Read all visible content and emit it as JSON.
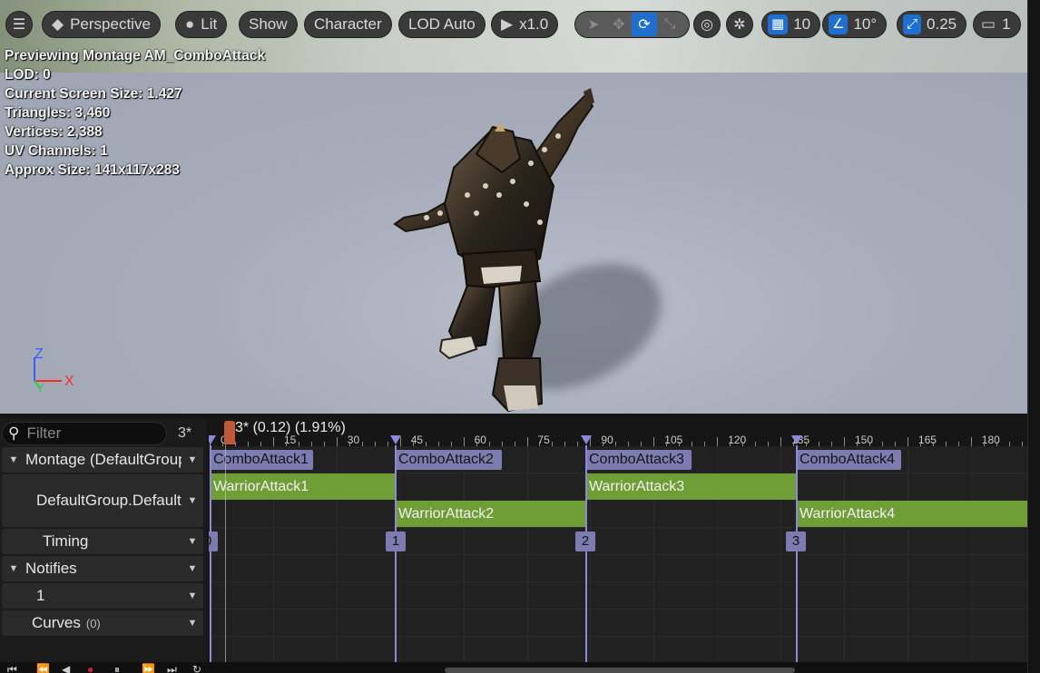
{
  "toolbar": {
    "menu_icon": "hamburger-icon",
    "view_mode": "Perspective",
    "lighting": "Lit",
    "show": "Show",
    "character": "Character",
    "lod": "LOD Auto",
    "play_speed": "x1.0",
    "grid_snap": "10",
    "rotation_snap": "10°",
    "scale_snap": "0.25",
    "camera_speed": "1"
  },
  "stats": {
    "previewing": "Previewing Montage AM_ComboAttack",
    "lod": "LOD: 0",
    "screen_size": "Current Screen Size: 1.427",
    "triangles": "Triangles: 3,460",
    "vertices": "Vertices: 2,388",
    "uv_channels": "UV Channels: 1",
    "approx_size": "Approx Size: 141x117x283"
  },
  "gizmo": {
    "z": "Z",
    "x": "X",
    "y": "Y"
  },
  "tracks": {
    "filter_placeholder": "Filter",
    "frame_count": "3*",
    "montage": "Montage (DefaultGroup)",
    "default_group": "DefaultGroup.DefaultSlot",
    "timing": "Timing",
    "notifies": "Notifies",
    "notify_track": "1",
    "curves": "Curves",
    "curves_count": "(0)"
  },
  "timeline": {
    "current_time": "3* (0.12) (1.91%)",
    "ruler_labels": [
      "0",
      "15",
      "30",
      "45",
      "60",
      "75",
      "90",
      "105",
      "120",
      "135",
      "150",
      "165",
      "180"
    ],
    "sections": [
      "ComboAttack1",
      "ComboAttack2",
      "ComboAttack3",
      "ComboAttack4"
    ],
    "animations": [
      "WarriorAttack1",
      "WarriorAttack2",
      "WarriorAttack3",
      "WarriorAttack4"
    ],
    "timing_markers": [
      "0",
      "1",
      "2",
      "3"
    ]
  },
  "colors": {
    "section": "#7c7cb0",
    "animation": "#6f9e37",
    "playhead": "#c0583b",
    "accent_blue": "#1f6fd0"
  }
}
